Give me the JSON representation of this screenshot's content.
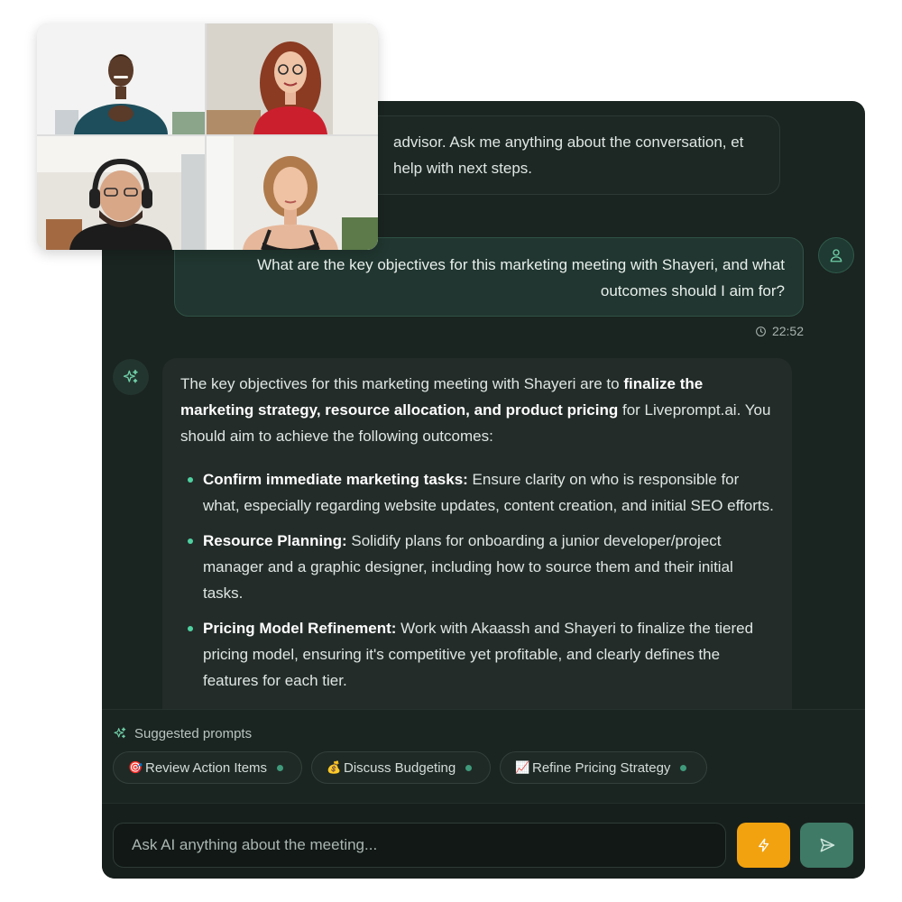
{
  "intro": {
    "text": "advisor. Ask me anything about the conversation, et help with next steps."
  },
  "user_message": {
    "text": "What are the key objectives for this marketing meeting with Shayeri, and what outcomes should I aim for?",
    "time": "22:52",
    "avatar_icon": "user-icon",
    "clock_icon": "clock-icon"
  },
  "ai_message": {
    "avatar_icon": "sparkles-icon",
    "intro_pre": "The key objectives for this marketing meeting with Shayeri are to ",
    "intro_bold": "finalize the marketing strategy, resource allocation, and product pricing",
    "intro_post": " for Liveprompt.ai. You should aim to achieve the following outcomes:",
    "bullets": [
      {
        "title": "Confirm immediate marketing tasks:",
        "text": " Ensure clarity on who is responsible for what, especially regarding website updates, content creation, and initial SEO efforts."
      },
      {
        "title": "Resource Planning:",
        "text": " Solidify plans for onboarding a junior developer/project manager and a graphic designer, including how to source them and their initial tasks."
      },
      {
        "title": "Pricing Model Refinement:",
        "text": " Work with Akaassh and Shayeri to finalize the tiered pricing model, ensuring it's competitive yet profitable, and clearly defines the features for each tier."
      }
    ]
  },
  "suggested": {
    "title": "Suggested prompts",
    "icon": "sparkles-icon",
    "chips": [
      {
        "emoji": "🎯",
        "label": "Review Action Items"
      },
      {
        "emoji": "💰",
        "label": "Discuss Budgeting"
      },
      {
        "emoji": "📈",
        "label": "Refine Pricing Strategy"
      }
    ]
  },
  "input": {
    "placeholder": "Ask AI anything about the meeting...",
    "bolt_icon": "bolt-icon",
    "send_icon": "send-icon"
  },
  "colors": {
    "panel_bg": "#1a2420",
    "accent_green": "#4fd1a1",
    "bolt_button": "#f2a20f",
    "send_button": "#3f7a67"
  }
}
